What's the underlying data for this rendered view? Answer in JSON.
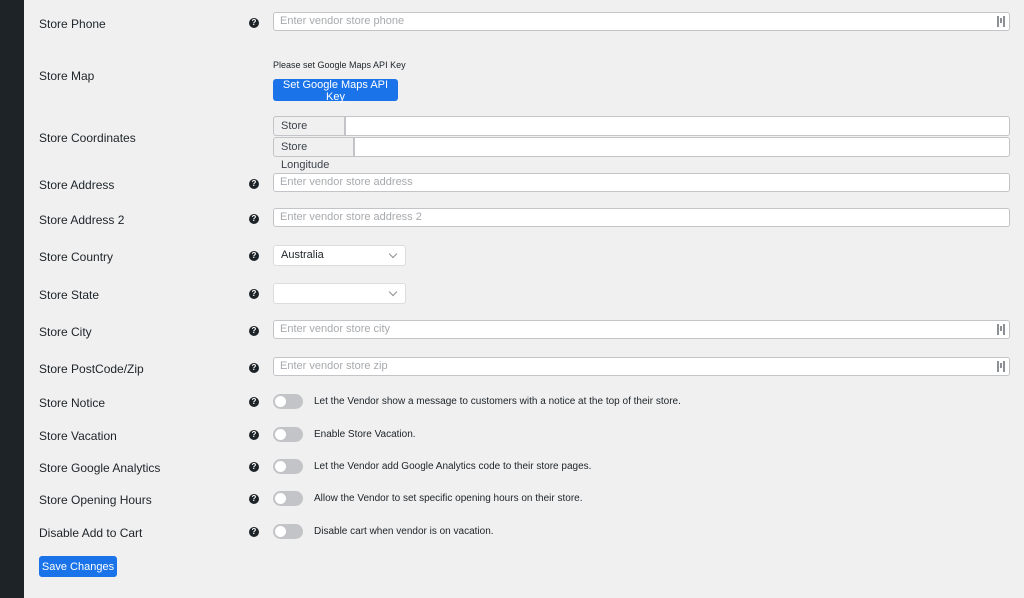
{
  "fields": {
    "store_phone": {
      "label": "Store Phone",
      "placeholder": "Enter vendor store phone",
      "value": ""
    },
    "store_map": {
      "label": "Store Map",
      "note": "Please set Google Maps API Key",
      "button": "Set Google Maps API Key"
    },
    "store_coordinates": {
      "label": "Store Coordinates",
      "latitude_label": "Store Latitude",
      "latitude_value": "",
      "longitude_label": "Store Longitude",
      "longitude_value": ""
    },
    "store_address": {
      "label": "Store Address",
      "placeholder": "Enter vendor store address",
      "value": ""
    },
    "store_address_2": {
      "label": "Store Address 2",
      "placeholder": "Enter vendor store address 2",
      "value": ""
    },
    "store_country": {
      "label": "Store Country",
      "selected": "Australia"
    },
    "store_state": {
      "label": "Store State",
      "selected": ""
    },
    "store_city": {
      "label": "Store City",
      "placeholder": "Enter vendor store city",
      "value": ""
    },
    "store_zip": {
      "label": "Store PostCode/Zip",
      "placeholder": "Enter vendor store zip",
      "value": ""
    }
  },
  "toggles": [
    {
      "label": "Store Notice",
      "text": "Let the Vendor show a message to customers with a notice at the top of their store.",
      "enabled": false
    },
    {
      "label": "Store Vacation",
      "text": "Enable Store Vacation.",
      "enabled": false
    },
    {
      "label": "Store Google Analytics",
      "text": "Let the Vendor add Google Analytics code to their store pages.",
      "enabled": false
    },
    {
      "label": "Store Opening Hours",
      "text": "Allow the Vendor to set specific opening hours on their store.",
      "enabled": false
    },
    {
      "label": "Disable Add to Cart",
      "text": "Disable cart when vendor is on vacation.",
      "enabled": false
    }
  ],
  "help_icon": "?",
  "save_button": "Save Changes"
}
